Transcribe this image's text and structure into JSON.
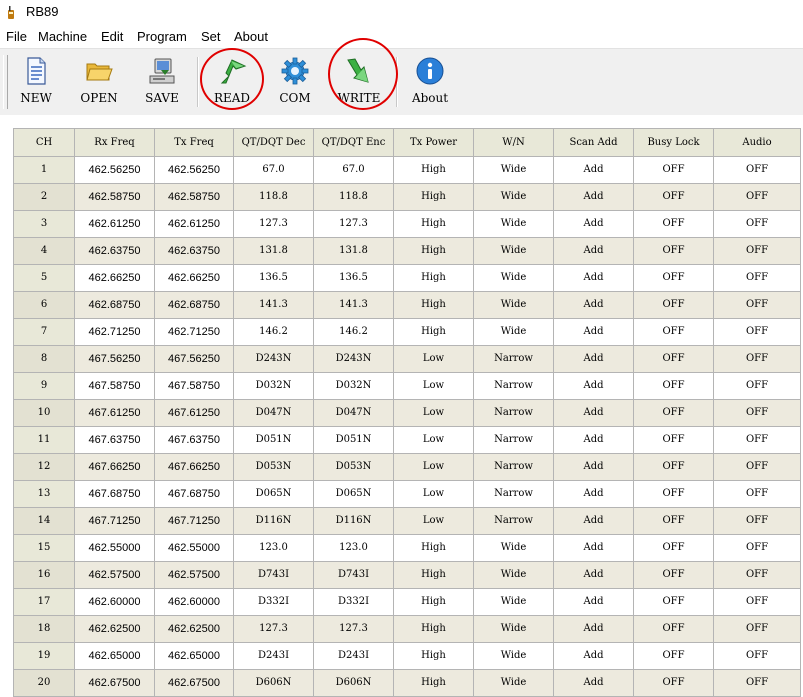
{
  "window": {
    "title": "RB89"
  },
  "menu": [
    "File",
    "Machine",
    "Edit",
    "Program",
    "Set",
    "About"
  ],
  "toolbar": {
    "new_label": "NEW",
    "open_label": "OPEN",
    "save_label": "SAVE",
    "read_label": "READ",
    "com_label": "COM",
    "write_label": "WRITE",
    "about_label": "About"
  },
  "table": {
    "columns": [
      "CH",
      "Rx Freq",
      "Tx Freq",
      "QT/DQT Dec",
      "QT/DQT Enc",
      "Tx Power",
      "W/N",
      "Scan Add",
      "Busy Lock",
      "Audio"
    ],
    "rows": [
      [
        "1",
        "462.56250",
        "462.56250",
        "67.0",
        "67.0",
        "High",
        "Wide",
        "Add",
        "OFF",
        "OFF"
      ],
      [
        "2",
        "462.58750",
        "462.58750",
        "118.8",
        "118.8",
        "High",
        "Wide",
        "Add",
        "OFF",
        "OFF"
      ],
      [
        "3",
        "462.61250",
        "462.61250",
        "127.3",
        "127.3",
        "High",
        "Wide",
        "Add",
        "OFF",
        "OFF"
      ],
      [
        "4",
        "462.63750",
        "462.63750",
        "131.8",
        "131.8",
        "High",
        "Wide",
        "Add",
        "OFF",
        "OFF"
      ],
      [
        "5",
        "462.66250",
        "462.66250",
        "136.5",
        "136.5",
        "High",
        "Wide",
        "Add",
        "OFF",
        "OFF"
      ],
      [
        "6",
        "462.68750",
        "462.68750",
        "141.3",
        "141.3",
        "High",
        "Wide",
        "Add",
        "OFF",
        "OFF"
      ],
      [
        "7",
        "462.71250",
        "462.71250",
        "146.2",
        "146.2",
        "High",
        "Wide",
        "Add",
        "OFF",
        "OFF"
      ],
      [
        "8",
        "467.56250",
        "467.56250",
        "D243N",
        "D243N",
        "Low",
        "Narrow",
        "Add",
        "OFF",
        "OFF"
      ],
      [
        "9",
        "467.58750",
        "467.58750",
        "D032N",
        "D032N",
        "Low",
        "Narrow",
        "Add",
        "OFF",
        "OFF"
      ],
      [
        "10",
        "467.61250",
        "467.61250",
        "D047N",
        "D047N",
        "Low",
        "Narrow",
        "Add",
        "OFF",
        "OFF"
      ],
      [
        "11",
        "467.63750",
        "467.63750",
        "D051N",
        "D051N",
        "Low",
        "Narrow",
        "Add",
        "OFF",
        "OFF"
      ],
      [
        "12",
        "467.66250",
        "467.66250",
        "D053N",
        "D053N",
        "Low",
        "Narrow",
        "Add",
        "OFF",
        "OFF"
      ],
      [
        "13",
        "467.68750",
        "467.68750",
        "D065N",
        "D065N",
        "Low",
        "Narrow",
        "Add",
        "OFF",
        "OFF"
      ],
      [
        "14",
        "467.71250",
        "467.71250",
        "D116N",
        "D116N",
        "Low",
        "Narrow",
        "Add",
        "OFF",
        "OFF"
      ],
      [
        "15",
        "462.55000",
        "462.55000",
        "123.0",
        "123.0",
        "High",
        "Wide",
        "Add",
        "OFF",
        "OFF"
      ],
      [
        "16",
        "462.57500",
        "462.57500",
        "D743I",
        "D743I",
        "High",
        "Wide",
        "Add",
        "OFF",
        "OFF"
      ],
      [
        "17",
        "462.60000",
        "462.60000",
        "D332I",
        "D332I",
        "High",
        "Wide",
        "Add",
        "OFF",
        "OFF"
      ],
      [
        "18",
        "462.62500",
        "462.62500",
        "127.3",
        "127.3",
        "High",
        "Wide",
        "Add",
        "OFF",
        "OFF"
      ],
      [
        "19",
        "462.65000",
        "462.65000",
        "D243I",
        "D243I",
        "High",
        "Wide",
        "Add",
        "OFF",
        "OFF"
      ],
      [
        "20",
        "462.67500",
        "462.67500",
        "D606N",
        "D606N",
        "High",
        "Wide",
        "Add",
        "OFF",
        "OFF"
      ]
    ]
  },
  "icons": {
    "app": "radio-icon",
    "new": "new-document-icon",
    "open": "open-folder-icon",
    "save": "save-computer-icon",
    "read": "read-arrow-up-icon",
    "com": "com-gear-icon",
    "write": "write-arrow-down-icon",
    "about": "info-icon"
  },
  "colors": {
    "annotation_circle": "#e00000",
    "header_bg": "#e8e8d8",
    "alt_row_bg": "#edeade",
    "toolbar_bg": "#f0f0f0"
  }
}
